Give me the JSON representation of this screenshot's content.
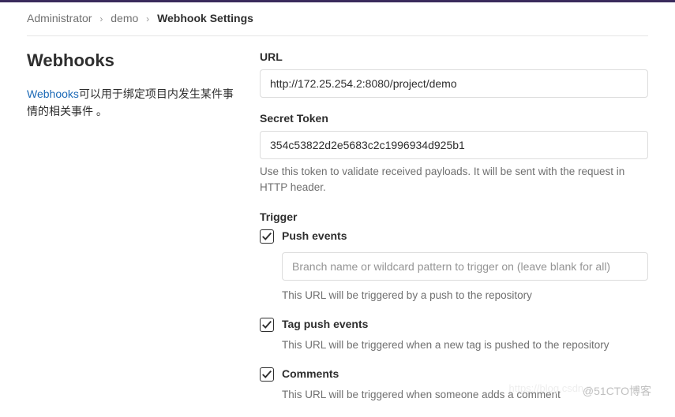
{
  "breadcrumb": {
    "admin": "Administrator",
    "project": "demo",
    "current": "Webhook Settings"
  },
  "sidebar": {
    "title": "Webhooks",
    "description_link": "Webhooks",
    "description_rest": "可以用于绑定项目内发生某件事情的相关事件 。"
  },
  "form": {
    "url_label": "URL",
    "url_value": "http://172.25.254.2:8080/project/demo",
    "secret_label": "Secret Token",
    "secret_value": "354c53822d2e5683c2c1996934d925b1",
    "secret_help": "Use this token to validate received payloads. It will be sent with the request in HTTP header.",
    "trigger_label": "Trigger"
  },
  "triggers": {
    "push": {
      "label": "Push events",
      "placeholder": "Branch name or wildcard pattern to trigger on (leave blank for all)",
      "help": "This URL will be triggered by a push to the repository",
      "checked": true
    },
    "tag": {
      "label": "Tag push events",
      "help": "This URL will be triggered when a new tag is pushed to the repository",
      "checked": true
    },
    "comments": {
      "label": "Comments",
      "help": "This URL will be triggered when someone adds a comment",
      "checked": true
    }
  },
  "watermark1": "@51CTO博客",
  "watermark2": "https://blog.csdn.n"
}
